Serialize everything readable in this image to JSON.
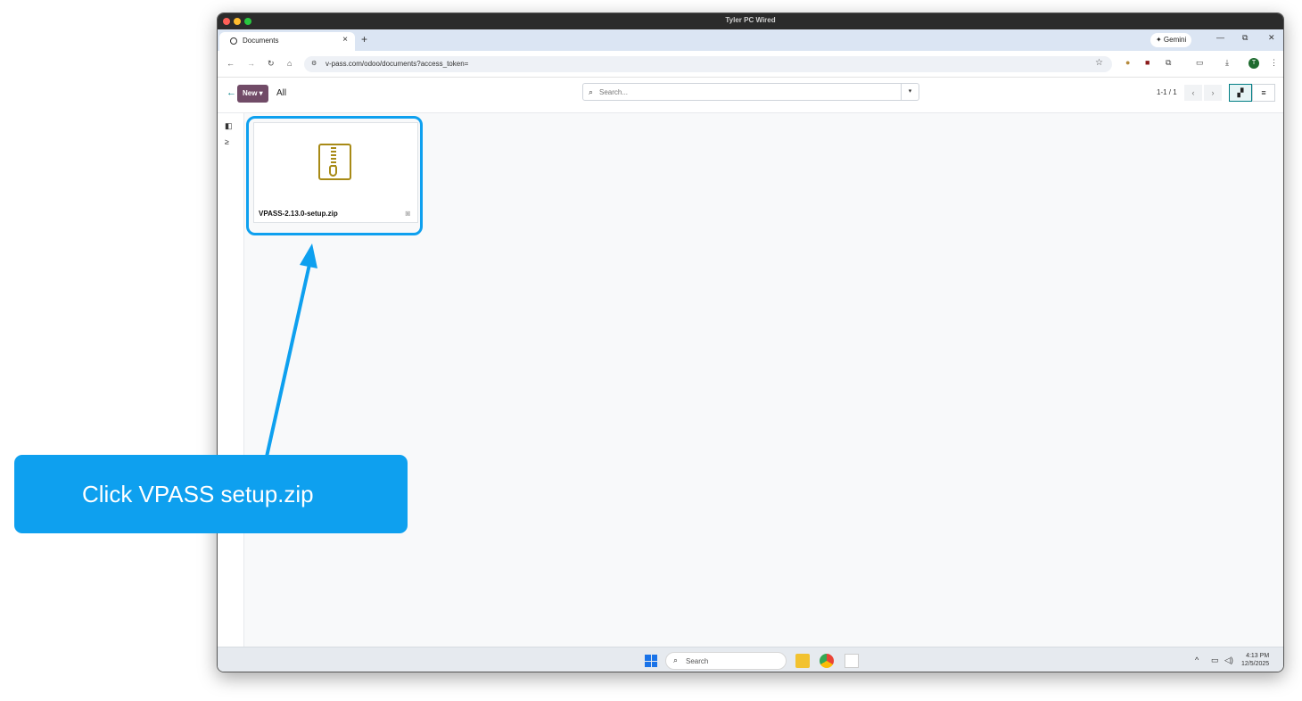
{
  "window": {
    "title": "Tyler PC Wired",
    "traffic_colors": [
      "#fe5f57",
      "#febc2e",
      "#28c840"
    ]
  },
  "browser": {
    "tab_title": "Documents",
    "tab_close": "×",
    "new_tab": "+",
    "gemini_label": "✦ Gemini",
    "window_controls": [
      "—",
      "⧉",
      "✕"
    ],
    "url": "v-pass.com/odoo/documents?access_token=",
    "profile_initial": "T"
  },
  "odoo": {
    "new_button": "New ▾",
    "breadcrumb": "All",
    "search_placeholder": "Search...",
    "pager": "1-1 / 1"
  },
  "documents": [
    {
      "name": "VPASS-2.13.0-setup.zip",
      "icon": "zip-file-icon"
    }
  ],
  "taskbar": {
    "search_label": "Search",
    "time": "4:13 PM",
    "date": "12/5/2025"
  },
  "annotation": {
    "callout_text": "Click VPASS setup.zip",
    "color": "#0ea0ef"
  }
}
